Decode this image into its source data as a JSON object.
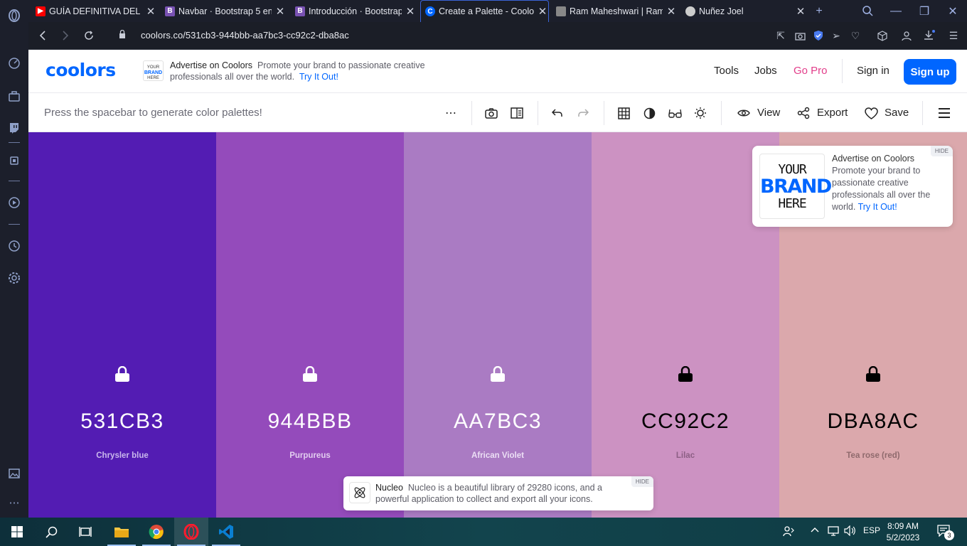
{
  "browser": {
    "tabs": [
      {
        "title": "GUÍA DEFINITIVA DEL PA",
        "icon": "youtube-icon",
        "color": "#ff0000"
      },
      {
        "title": "Navbar · Bootstrap 5 en",
        "icon": "bootstrap-icon",
        "color": "#7952b3"
      },
      {
        "title": "Introducción · Bootstrap",
        "icon": "bootstrap-icon",
        "color": "#7952b3"
      },
      {
        "title": "Create a Palette - Coolo",
        "icon": "coolors-icon",
        "color": "#0066ff"
      },
      {
        "title": "Ram Maheshwari | Ramn",
        "icon": "avatar-icon",
        "color": "#888888"
      },
      {
        "title": "Nuñez Joel",
        "icon": "globe-icon",
        "color": "#cccccc"
      }
    ],
    "url": "coolors.co/531cb3-944bbb-aa7bc3-cc92c2-dba8ac"
  },
  "header": {
    "logo": "coolors",
    "ad_badge": [
      "YOUR",
      "BRAND",
      "HERE"
    ],
    "ad_title": "Advertise on Coolors",
    "ad_body": "Promote your brand to passionate creative professionals all over the world.",
    "ad_link": "Try It Out!",
    "nav": {
      "tools": "Tools",
      "jobs": "Jobs",
      "pro": "Go Pro",
      "signin": "Sign in",
      "signup": "Sign up"
    }
  },
  "toolbar": {
    "hint": "Press the spacebar to generate color palettes!",
    "view": "View",
    "export": "Export",
    "save": "Save"
  },
  "palette": [
    {
      "hex": "531CB3",
      "name": "Chrysler blue",
      "bg": "#531cb3",
      "fg": "#ffffff",
      "sub": "#c9b8ec",
      "locked": false
    },
    {
      "hex": "944BBB",
      "name": "Purpureus",
      "bg": "#944bbb",
      "fg": "#ffffff",
      "sub": "#e2cdef",
      "locked": false
    },
    {
      "hex": "AA7BC3",
      "name": "African Violet",
      "bg": "#aa7bc3",
      "fg": "#ffffff",
      "sub": "#ecdff5",
      "locked": false
    },
    {
      "hex": "CC92C2",
      "name": "Lilac",
      "bg": "#cc92c2",
      "fg": "#000000",
      "sub": "#8c5f84",
      "locked": true
    },
    {
      "hex": "DBA8AC",
      "name": "Tea rose (red)",
      "bg": "#dba8ac",
      "fg": "#000000",
      "sub": "#8f6a6d",
      "locked": true
    }
  ],
  "ad_card": {
    "brand": [
      "YOUR",
      "BRAND",
      "HERE"
    ],
    "title": "Advertise on Coolors",
    "body": "Promote your brand to passionate creative professionals all over the world.",
    "link": "Try It Out!",
    "hide": "HIDE"
  },
  "nucleo": {
    "title": "Nucleo",
    "body": "Nucleo is a beautiful library of 29280 icons, and a powerful application to collect and export all your icons.",
    "hide": "HIDE"
  },
  "taskbar": {
    "lang": "ESP",
    "time": "8:09 AM",
    "date": "5/2/2023",
    "notifications": "3"
  }
}
